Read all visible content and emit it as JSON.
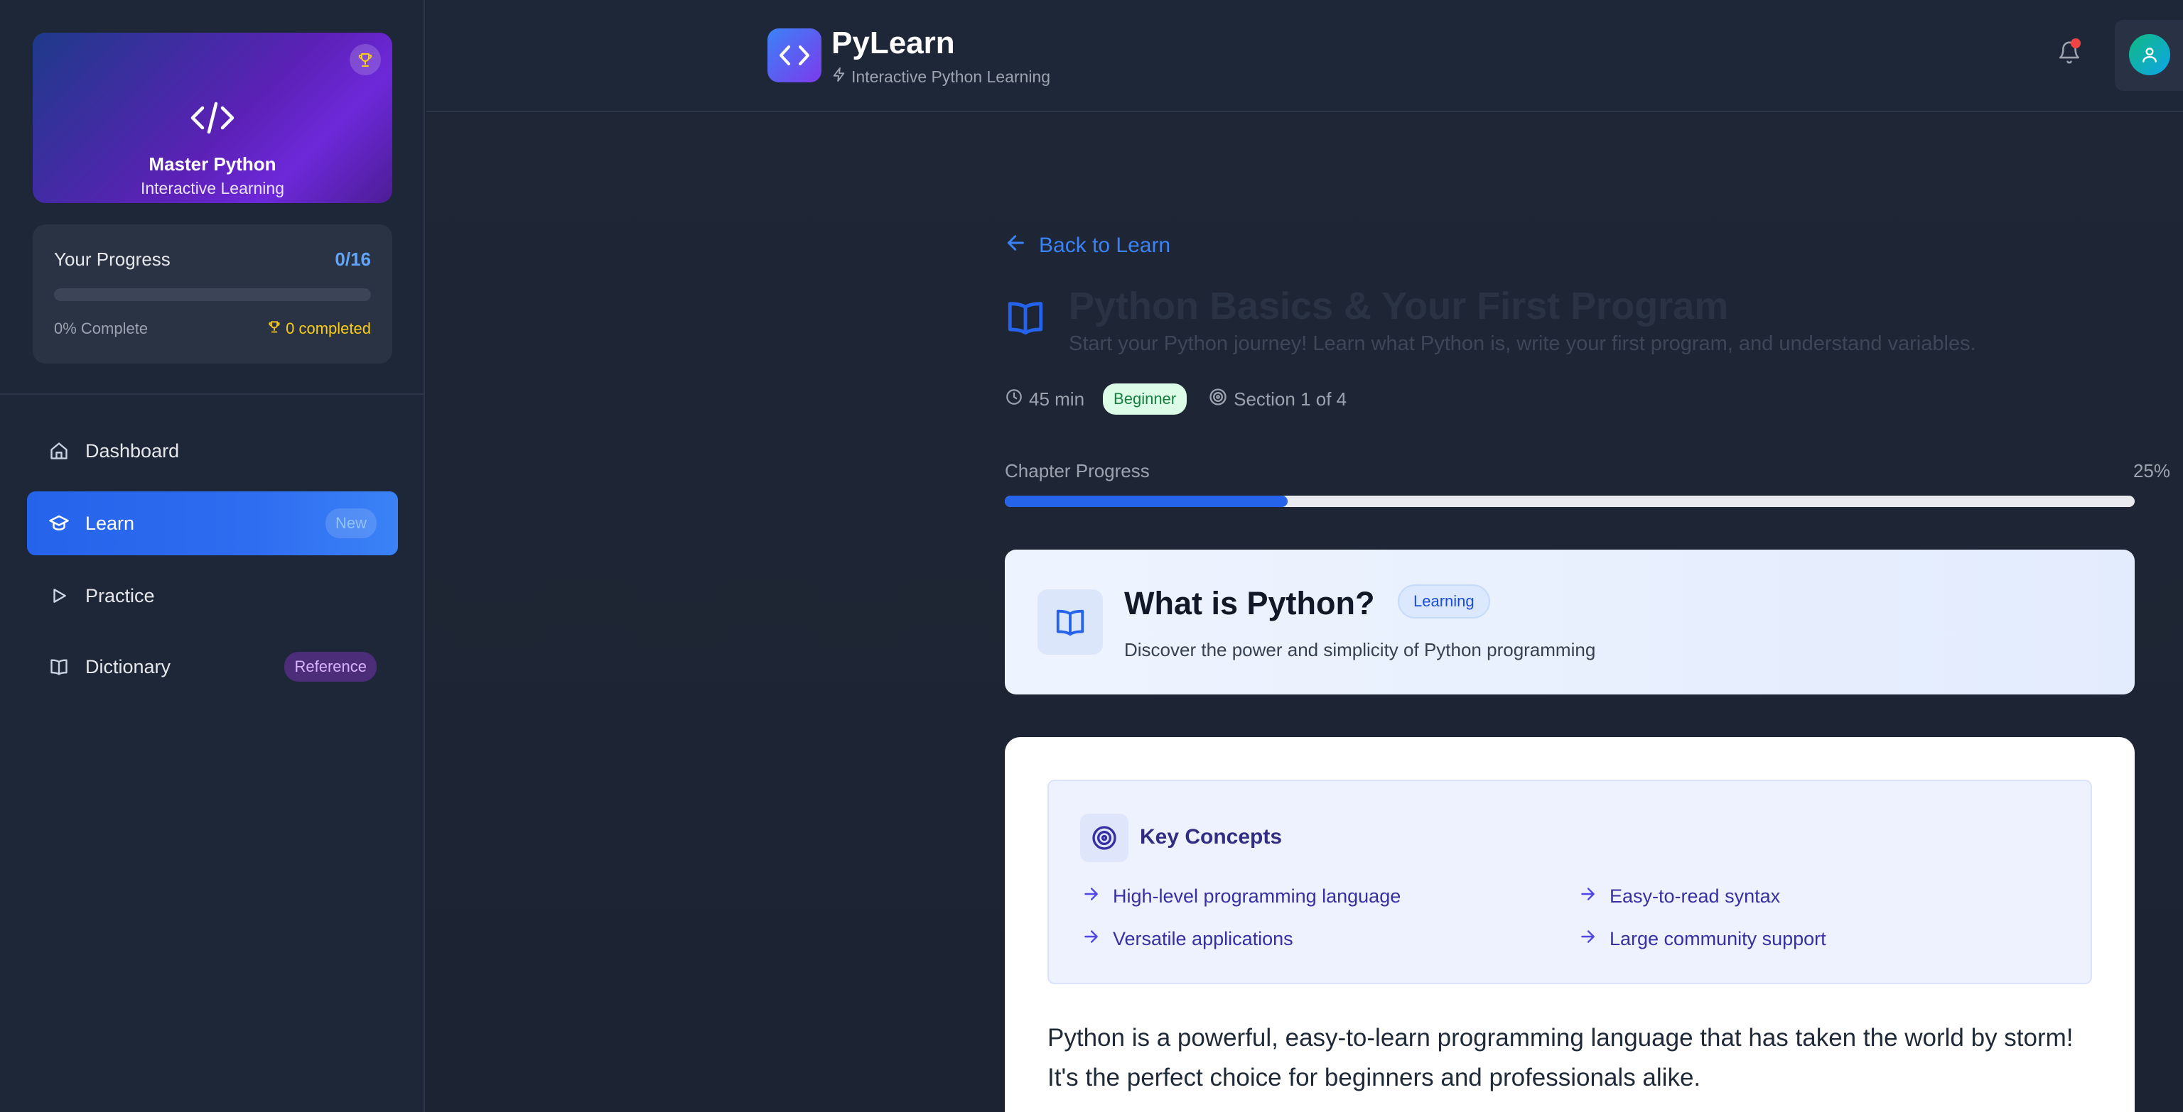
{
  "sidebar": {
    "brand": {
      "title": "Master Python",
      "subtitle": "Interactive Learning"
    },
    "progress": {
      "title": "Your Progress",
      "count": "0/16",
      "fraction": 0,
      "percent_text": "0% Complete",
      "completed_text": "0 completed"
    },
    "nav": [
      {
        "label": "Dashboard",
        "icon": "home-icon",
        "badge": ""
      },
      {
        "label": "Learn",
        "icon": "graduation-cap-icon",
        "badge": "New",
        "active": true
      },
      {
        "label": "Practice",
        "icon": "play-icon",
        "badge": ""
      },
      {
        "label": "Dictionary",
        "icon": "book-icon",
        "badge": "Reference"
      }
    ]
  },
  "header": {
    "title": "PyLearn",
    "tagline": "Interactive Python Learning",
    "notification_indicator": true
  },
  "chapter": {
    "back_label": "Back to Learn",
    "title": "Python Basics & Your First Program",
    "description": "Start your Python journey! Learn what Python is, write your first program, and understand variables.",
    "duration": "45 min",
    "level": "Beginner",
    "section_label": "Section 1 of 4",
    "progress_label": "Chapter Progress",
    "progress_text": "25%",
    "progress_fraction": 0.25
  },
  "section": {
    "title": "What is Python?",
    "badge": "Learning",
    "subtitle": "Discover the power and simplicity of Python programming"
  },
  "concepts": {
    "title": "Key Concepts",
    "items": [
      "High-level programming language",
      "Easy-to-read syntax",
      "Versatile applications",
      "Large community support"
    ]
  },
  "content": {
    "intro": "Python is a powerful, easy-to-learn programming language that has taken the world by storm! It's the perfect choice for beginners and professionals alike."
  },
  "colors": {
    "accent": "#2563eb",
    "brand_gradient_start": "#1e3a8a",
    "brand_gradient_end": "#6d28d9",
    "beginner_badge": "#dcfce7",
    "notification_dot": "#ef4444"
  }
}
